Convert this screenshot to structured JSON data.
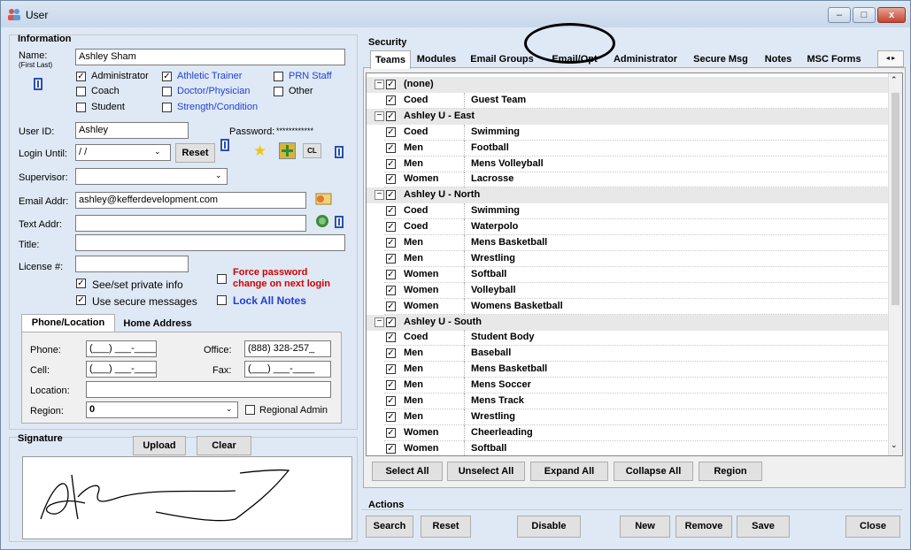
{
  "window": {
    "title": "User",
    "min": "–",
    "max": "□",
    "close": "x"
  },
  "info": {
    "title": "Information",
    "name_label": "Name:",
    "name_hint": "(First Last)",
    "name_value": "Ashley Sham",
    "roles": [
      {
        "label": "Administrator",
        "checked": true,
        "blue": false
      },
      {
        "label": "Athletic Trainer",
        "checked": true,
        "blue": true
      },
      {
        "label": "PRN Staff",
        "checked": false,
        "blue": true
      },
      {
        "label": "Coach",
        "checked": false,
        "blue": false
      },
      {
        "label": "Doctor/Physician",
        "checked": false,
        "blue": true
      },
      {
        "label": "Other",
        "checked": false,
        "blue": false
      },
      {
        "label": "Student",
        "checked": false,
        "blue": false
      },
      {
        "label": "Strength/Condition",
        "checked": false,
        "blue": true
      }
    ],
    "userid_label": "User ID:",
    "userid_value": "Ashley",
    "password_label": "Password:",
    "password_value": "************",
    "login_label": "Login Until:",
    "login_value": " /  /",
    "reset_label": "Reset",
    "cl_label": "CL",
    "supervisor_label": "Supervisor:",
    "email_label": "Email Addr:",
    "email_value": "ashley@kefferdevelopment.com",
    "text_label": "Text Addr:",
    "title_label": "Title:",
    "license_label": "License #:",
    "see_private": "See/set private info",
    "use_secure": "Use secure messages",
    "force_pw_1": "Force password",
    "force_pw_2": "change on next login",
    "lock_notes": "Lock All Notes"
  },
  "phone": {
    "tabs": [
      "Phone/Location",
      "Home Address"
    ],
    "phone_label": "Phone:",
    "phone_value": "(___) ___-____",
    "office_label": "Office:",
    "office_value": "(888) 328-257_",
    "cell_label": "Cell:",
    "cell_value": "(___) ___-____",
    "fax_label": "Fax:",
    "fax_value": "(___) ___-____",
    "location_label": "Location:",
    "region_label": "Region:",
    "region_value": "0",
    "regional_admin": "Regional Admin"
  },
  "signature": {
    "title": "Signature",
    "upload": "Upload",
    "clear": "Clear"
  },
  "security": {
    "title": "Security",
    "tabs": [
      "Teams",
      "Modules",
      "Email Groups",
      "Email/Opt",
      "Administrator",
      "Secure Msg",
      "Notes",
      "MSC Forms"
    ],
    "rows": [
      {
        "type": "group",
        "name": "(none)"
      },
      {
        "type": "item",
        "gender": "Coed",
        "team": "Guest Team"
      },
      {
        "type": "group",
        "name": "Ashley U -  East"
      },
      {
        "type": "item",
        "gender": "Coed",
        "team": "Swimming"
      },
      {
        "type": "item",
        "gender": "Men",
        "team": "Football"
      },
      {
        "type": "item",
        "gender": "Men",
        "team": "Mens Volleyball"
      },
      {
        "type": "item",
        "gender": "Women",
        "team": "Lacrosse"
      },
      {
        "type": "group",
        "name": "Ashley U -  North"
      },
      {
        "type": "item",
        "gender": "Coed",
        "team": "Swimming"
      },
      {
        "type": "item",
        "gender": "Coed",
        "team": "Waterpolo"
      },
      {
        "type": "item",
        "gender": "Men",
        "team": "Mens Basketball"
      },
      {
        "type": "item",
        "gender": "Men",
        "team": "Wrestling"
      },
      {
        "type": "item",
        "gender": "Women",
        "team": "Softball"
      },
      {
        "type": "item",
        "gender": "Women",
        "team": "Volleyball"
      },
      {
        "type": "item",
        "gender": "Women",
        "team": "Womens Basketball"
      },
      {
        "type": "group",
        "name": "Ashley U -  South"
      },
      {
        "type": "item",
        "gender": "Coed",
        "team": "Student Body"
      },
      {
        "type": "item",
        "gender": "Men",
        "team": "Baseball"
      },
      {
        "type": "item",
        "gender": "Men",
        "team": "Mens Basketball"
      },
      {
        "type": "item",
        "gender": "Men",
        "team": "Mens Soccer"
      },
      {
        "type": "item",
        "gender": "Men",
        "team": "Mens Track"
      },
      {
        "type": "item",
        "gender": "Men",
        "team": "Wrestling"
      },
      {
        "type": "item",
        "gender": "Women",
        "team": "Cheerleading"
      },
      {
        "type": "item",
        "gender": "Women",
        "team": "Softball"
      }
    ],
    "buttons": [
      "Select All",
      "Unselect All",
      "Expand All",
      "Collapse All",
      "Region"
    ]
  },
  "actions": {
    "title": "Actions",
    "search": "Search",
    "reset": "Reset",
    "disable": "Disable",
    "new": "New",
    "remove": "Remove",
    "save": "Save",
    "close": "Close"
  }
}
